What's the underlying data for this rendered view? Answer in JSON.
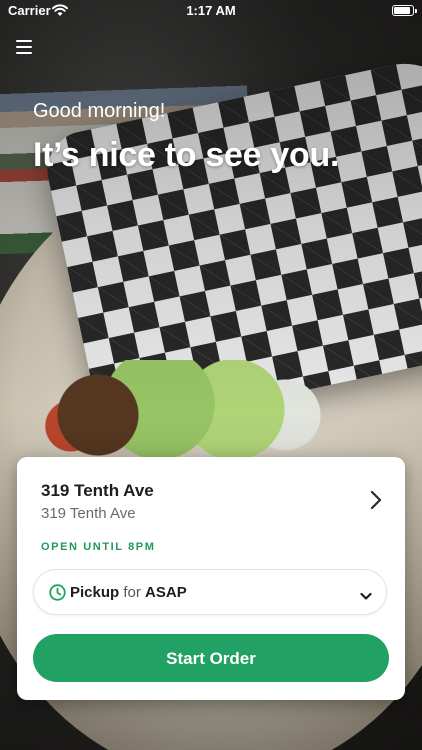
{
  "status_bar": {
    "carrier": "Carrier",
    "time": "1:17 AM",
    "battery_level": 1.0
  },
  "greeting": {
    "small": "Good morning!",
    "large": "It’s nice to see you."
  },
  "location": {
    "name": "319 Tenth Ave",
    "address": "319 Tenth Ave",
    "hours_status": "OPEN UNTIL 8PM"
  },
  "order_mode": {
    "mode": "Pickup",
    "connector": "for",
    "time": "ASAP"
  },
  "actions": {
    "start_order": "Start Order"
  },
  "colors": {
    "accent_green": "#21a264",
    "status_green": "#1f9a5b"
  },
  "icons": {
    "menu": "hamburger-icon",
    "wifi": "wifi-icon",
    "battery": "battery-icon",
    "location_chevron": "chevron-right-icon",
    "clock": "clock-icon",
    "dropdown": "chevron-down-icon"
  }
}
